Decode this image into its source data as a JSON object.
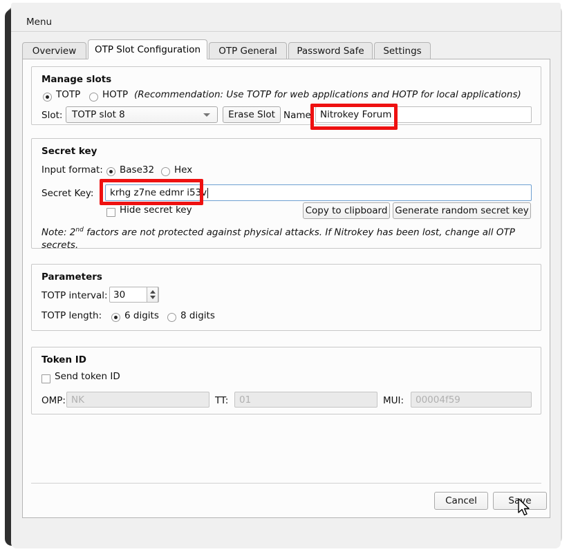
{
  "window": {
    "menubar_label": "Menu"
  },
  "tabs": [
    {
      "label": "Overview",
      "active": false
    },
    {
      "label": "OTP Slot Configuration",
      "active": true
    },
    {
      "label": "OTP General",
      "active": false
    },
    {
      "label": "Password Safe",
      "active": false
    },
    {
      "label": "Settings",
      "active": false
    }
  ],
  "manage_slots": {
    "title": "Manage slots",
    "totp_radio_label": "TOTP",
    "hotp_radio_label": "HOTP",
    "selected_type": "TOTP",
    "recommendation": "(Recommendation: Use TOTP for web applications and HOTP for local applications)",
    "slot_label": "Slot:",
    "slot_value": "TOTP slot 8",
    "erase_slot_button": "Erase Slot",
    "name_label": "Name:",
    "name_value": "Nitrokey Forum"
  },
  "secret_key": {
    "title": "Secret key",
    "input_format_label": "Input format:",
    "base32_label": "Base32",
    "hex_label": "Hex",
    "selected_format": "Base32",
    "secret_key_label": "Secret Key:",
    "secret_key_value": "krhg z7ne edmr i53v",
    "hide_secret_key_label": "Hide secret key",
    "hide_secret_key_checked": false,
    "copy_button": "Copy to clipboard",
    "generate_button": "Generate random secret key",
    "note_prefix": "Note: 2",
    "note_sup": "nd",
    "note_rest": " factors are not protected against physical attacks. If Nitrokey has been lost, change all OTP secrets."
  },
  "parameters": {
    "title": "Parameters",
    "interval_label": "TOTP interval:",
    "interval_value": "30",
    "length_label": "TOTP length:",
    "six_digits_label": "6 digits",
    "eight_digits_label": "8 digits",
    "selected_length": "6 digits"
  },
  "token_id": {
    "title": "Token ID",
    "send_token_id_label": "Send token ID",
    "send_token_id_checked": false,
    "omp_label": "OMP:",
    "omp_placeholder": "NK",
    "tt_label": "TT:",
    "tt_placeholder": "01",
    "mui_label": "MUI:",
    "mui_placeholder": "00004f59"
  },
  "footer": {
    "cancel_button": "Cancel",
    "save_button": "Save"
  },
  "annotations": {
    "highlight_color": "#ee1111",
    "highlighted_fields": [
      "name_value",
      "secret_key_value"
    ]
  }
}
